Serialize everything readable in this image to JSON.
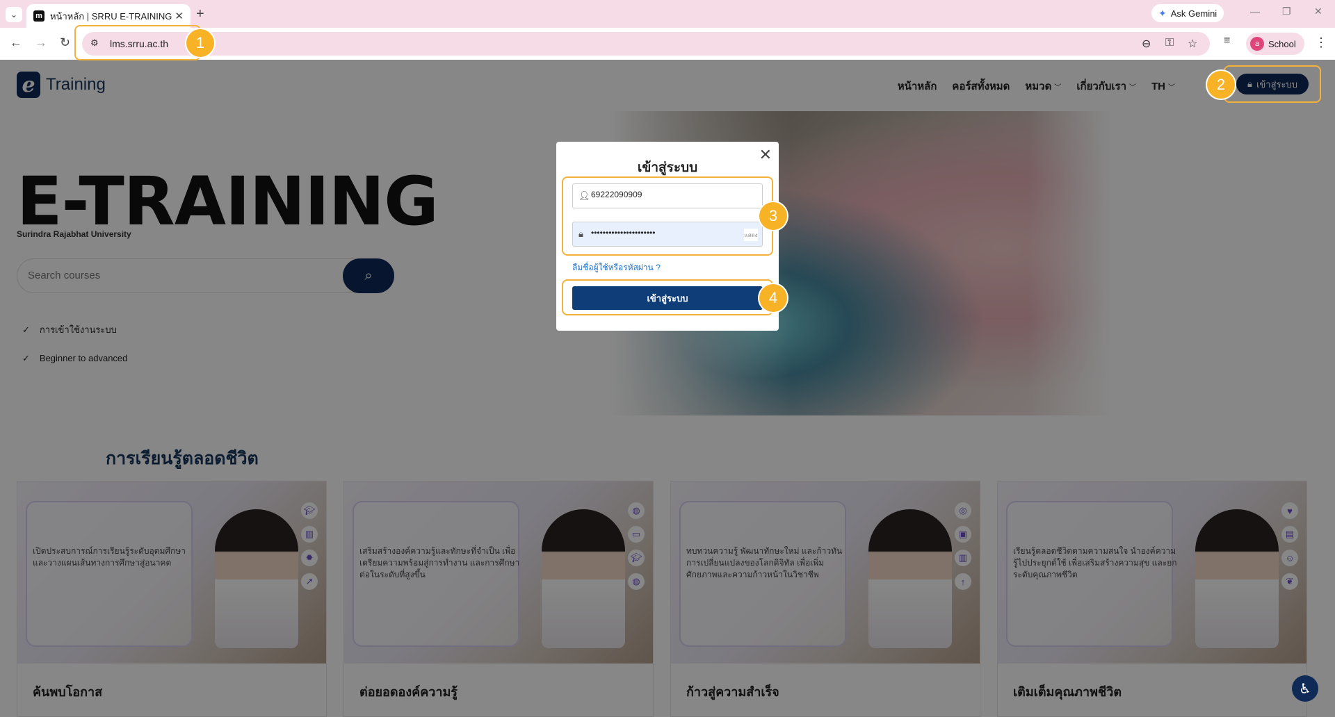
{
  "browser": {
    "tab_title": "หน้าหลัก | SRRU E-TRAINING",
    "favicon_letter": "m",
    "url": "lms.srru.ac.th",
    "gemini_label": "Ask Gemini",
    "profile_initial": "a",
    "profile_label": "School",
    "icons": [
      "tab-search-icon",
      "tab-close-icon",
      "new-tab-icon",
      "back-icon",
      "forward-icon",
      "reload-icon",
      "site-info-icon",
      "zoom-icon",
      "password-key-icon",
      "bookmark-star-icon",
      "reading-list-icon",
      "menu-icon"
    ]
  },
  "site": {
    "logo_letter": "e",
    "logo_text": "Training",
    "nav": [
      "หน้าหลัก",
      "คอร์สทั้งหมด",
      "หมวด",
      "เกี่ยวกับเรา",
      "TH"
    ],
    "login_label": "เข้าสู่ระบบ"
  },
  "hero": {
    "title": "E-TRAINING",
    "subtitle": "Surindra Rajabhat University",
    "search_placeholder": "Search courses",
    "checks": [
      "การเข้าใช้งานระบบ",
      "Beginner to advanced"
    ]
  },
  "section": {
    "title": "การเรียนรู้ตลอดชีวิต",
    "cards": [
      {
        "title": "ค้นพบโอกาส",
        "desc": "เปิดประสบการณ์การเรียนรู้ระดับอุดมศึกษา และวางแผนเส้นทางการศึกษาสู่อนาคต"
      },
      {
        "title": "ต่อยอดองค์ความรู้",
        "desc": "เสริมสร้างองค์ความรู้และทักษะที่จำเป็น เพื่อเตรียมความพร้อมสู่การทำงาน และการศึกษาต่อในระดับที่สูงขึ้น"
      },
      {
        "title": "ก้าวสู่ความสำเร็จ",
        "desc": "ทบทวนความรู้ พัฒนาทักษะใหม่ และก้าวทันการเปลี่ยนแปลงของโลกดิจิทัล เพื่อเพิ่มศักยภาพและความก้าวหน้าในวิชาชีพ"
      },
      {
        "title": "เติมเต็มคุณภาพชีวิต",
        "desc": "เรียนรู้ตลอดชีวิตตามความสนใจ นำองค์ความรู้ไปประยุกต์ใช้ เพื่อเสริมสร้างความสุข และยกระดับคุณภาพชีวิต"
      }
    ]
  },
  "modal": {
    "title": "เข้าสู่ระบบ",
    "username_value": "69222090909",
    "password_value": "••••••••••••••••••••••",
    "show_password_label": "แสดง",
    "forgot_label": "ลืมชื่อผู้ใช้หรือรหัสผ่าน ?",
    "submit_label": "เข้าสู่ระบบ"
  },
  "annotations": [
    "1",
    "2",
    "3",
    "4"
  ],
  "colors": {
    "accent": "#0f2a57",
    "highlight": "#f4b23a",
    "marker": "#f7b226",
    "tabstrip": "#f6dce6"
  }
}
